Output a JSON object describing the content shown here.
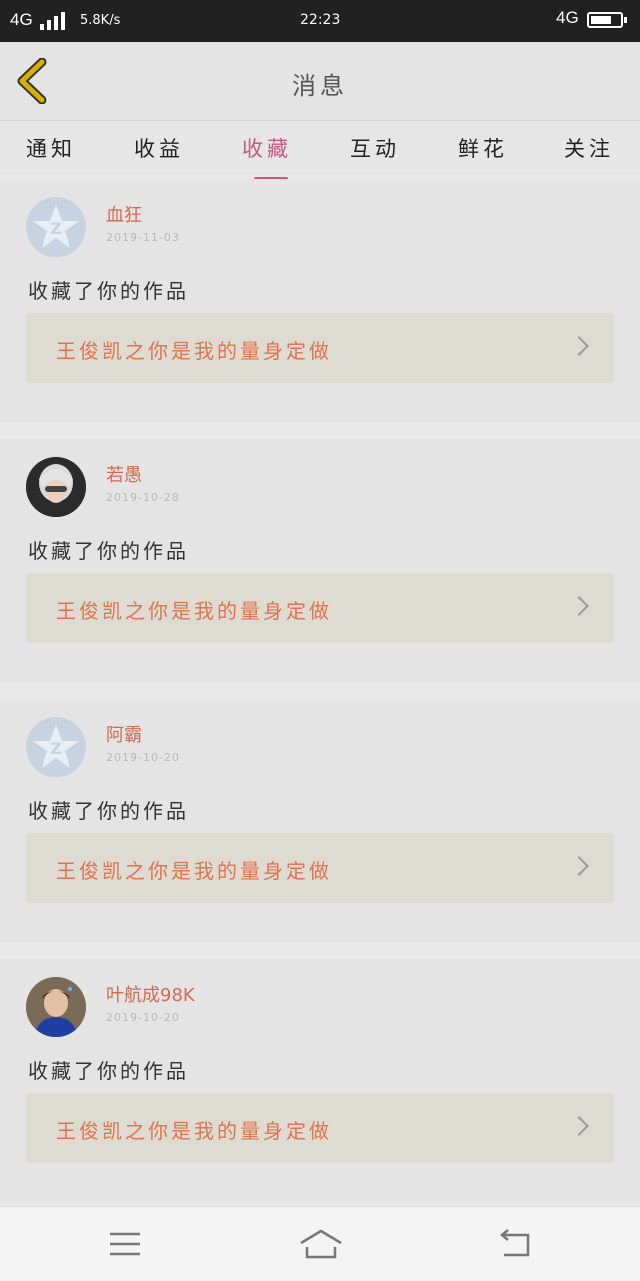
{
  "status": {
    "net": "4G",
    "speed": "5.8K/s",
    "time": "22:23",
    "net2": "4G"
  },
  "header": {
    "title": "消息"
  },
  "tabs": [
    {
      "label": "通知",
      "active": false
    },
    {
      "label": "收益",
      "active": false
    },
    {
      "label": "收藏",
      "active": true
    },
    {
      "label": "互动",
      "active": false
    },
    {
      "label": "鲜花",
      "active": false
    },
    {
      "label": "关注",
      "active": false
    }
  ],
  "items": [
    {
      "name": "血狂",
      "date": "2019-11-03",
      "action": "收藏了你的作品",
      "work": "王俊凯之你是我的量身定做",
      "avatar": "qzone-icon"
    },
    {
      "name": "若愚",
      "date": "2019-10-28",
      "action": "收藏了你的作品",
      "work": "王俊凯之你是我的量身定做",
      "avatar": "user-photo"
    },
    {
      "name": "阿霸",
      "date": "2019-10-20",
      "action": "收藏了你的作品",
      "work": "王俊凯之你是我的量身定做",
      "avatar": "qzone-icon"
    },
    {
      "name": "叶航成98K",
      "date": "2019-10-20",
      "action": "收藏了你的作品",
      "work": "王俊凯之你是我的量身定做",
      "avatar": "user-photo"
    }
  ],
  "colors": {
    "accent": "#c45a80",
    "name": "#d06b52",
    "work_title": "#e0734d",
    "back": "#d8b000"
  }
}
